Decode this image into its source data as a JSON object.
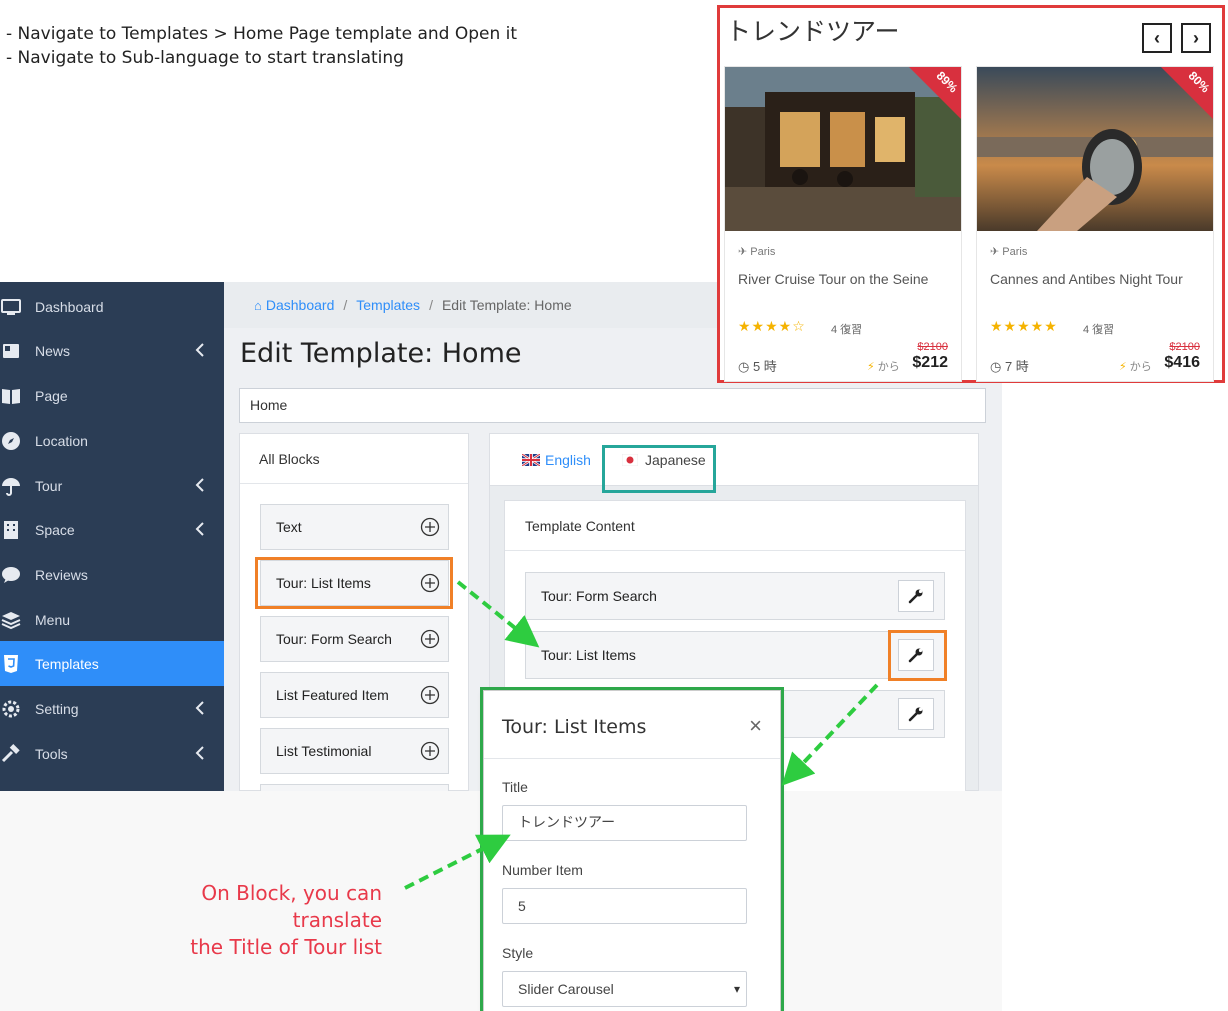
{
  "instructions": [
    "-  Navigate to Templates > Home Page template and Open it",
    "-  Navigate to Sub-language to start translating"
  ],
  "sidebar": {
    "items": [
      {
        "label": "Dashboard",
        "icon": "monitor-icon"
      },
      {
        "label": "News",
        "icon": "newspaper-icon"
      },
      {
        "label": "Page",
        "icon": "book-icon"
      },
      {
        "label": "Location",
        "icon": "compass-icon"
      },
      {
        "label": "Tour",
        "icon": "umbrella-icon"
      },
      {
        "label": "Space",
        "icon": "building-icon"
      },
      {
        "label": "Reviews",
        "icon": "comment-icon"
      },
      {
        "label": "Menu",
        "icon": "layers-icon"
      },
      {
        "label": "Templates",
        "icon": "html5-icon"
      },
      {
        "label": "Setting",
        "icon": "gear-icon"
      },
      {
        "label": "Tools",
        "icon": "hammer-icon"
      }
    ]
  },
  "breadcrumb": {
    "home": "Dashboard",
    "templates": "Templates",
    "current": "Edit Template: Home"
  },
  "page_title": "Edit Template: Home",
  "template_name": "Home",
  "blocks_panel": {
    "header": "All Blocks",
    "items": [
      "Text",
      "Tour: List Items",
      "Tour: Form Search",
      "List Featured Item",
      "List Testimonial"
    ]
  },
  "languages": {
    "english": "English",
    "japanese": "Japanese"
  },
  "template_content": {
    "header": "Template Content",
    "items": [
      "Tour: Form Search",
      "Tour: List Items"
    ]
  },
  "modal": {
    "title": "Tour: List Items",
    "close": "×",
    "title_label": "Title",
    "title_value": "トレンドツアー",
    "number_label": "Number Item",
    "number_value": "5",
    "style_label": "Style",
    "style_value": "Slider Carousel"
  },
  "note": {
    "line1": "On Block, you can translate",
    "line2": "the Title of Tour list"
  },
  "preview": {
    "title": "トレンドツアー",
    "prev": "‹",
    "next": "›",
    "cards": [
      {
        "discount": "89%",
        "location": "Paris",
        "title": "River Cruise Tour on the Seine",
        "stars": "★★★★☆",
        "reviews": "4 復習",
        "duration": "5 時",
        "from": "から",
        "old_price": "$2100",
        "price": "$212"
      },
      {
        "discount": "80%",
        "location": "Paris",
        "title": "Cannes and Antibes Night Tour",
        "stars": "★★★★★",
        "reviews": "4 復習",
        "duration": "7 時",
        "from": "から",
        "old_price": "$2100",
        "price": "$416"
      }
    ]
  },
  "colors": {
    "sidebar_bg": "#2b3d55",
    "accent": "#2f8ef9",
    "highlight_orange": "#f08027",
    "highlight_green": "#26a69a",
    "arrow_green": "#2ecc40",
    "preview_border": "#e03b3b",
    "note_red": "#e8394a"
  }
}
